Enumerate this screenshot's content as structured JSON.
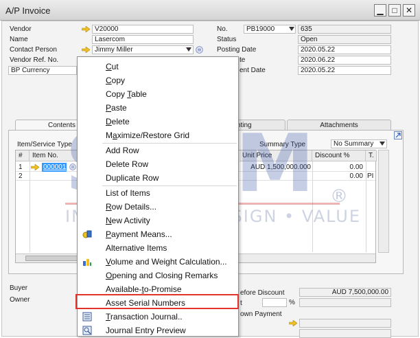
{
  "window": {
    "title": "A/P Invoice",
    "buttons": [
      "▁",
      "□",
      "✕"
    ]
  },
  "header": {
    "left": [
      {
        "label": "Vendor",
        "value": "V20000",
        "link": true
      },
      {
        "label": "Name",
        "value": "Lasercom"
      },
      {
        "label": "Contact Person",
        "value": "Jimmy Miller",
        "dropdown": true
      },
      {
        "label": "Vendor Ref. No.",
        "value": ""
      },
      {
        "label": "BP Currency",
        "value": ""
      }
    ],
    "right": {
      "no_label": "No.",
      "series": "PB19000",
      "number": "635",
      "status_label": "Status",
      "status_value": "Open",
      "posting_label": "Posting Date",
      "posting_value": "2020.05.22",
      "due_label_partial": "te",
      "due_value": "2020.06.22",
      "doc_label_partial": "ent Date",
      "doc_value": "2020.05.22"
    }
  },
  "tabs": {
    "contents": "Contents",
    "accounting_partial": "unting",
    "attachments": "Attachments"
  },
  "contents": {
    "item_type_label": "Item/Service Type",
    "summary_label": "Summary Type",
    "summary_value": "No Summary",
    "columns": [
      "#",
      "Item No.",
      "Unit Price",
      "Discount %",
      "T."
    ],
    "rows": [
      {
        "num": "1",
        "item": "000001",
        "unit_price": "AUD 1,500,000.000",
        "discount": "0.00",
        "tax": ""
      },
      {
        "num": "2",
        "item": "",
        "unit_price": "",
        "discount": "0.00",
        "tax": "PI"
      }
    ]
  },
  "footer": {
    "buyer_label": "Buyer",
    "owner_label": "Owner",
    "before_discount_label_partial": "efore Discount",
    "before_discount_value": "AUD 7,500,000.00",
    "discount_label_partial": "t",
    "percent_sign": "%",
    "down_payment_label_partial": "own Payment"
  },
  "context_menu": {
    "items": [
      {
        "label": "Cut",
        "mnemonic_index": 0
      },
      {
        "label": "Copy",
        "mnemonic_index": 0
      },
      {
        "label": "Copy Table",
        "mnemonic_index": 5
      },
      {
        "label": "Paste",
        "mnemonic_index": 0
      },
      {
        "label": "Delete",
        "mnemonic_index": 0
      },
      {
        "label": "Maximize/Restore Grid",
        "mnemonic_index": 1
      },
      {
        "label": "Add Row",
        "mnemonic_index": -1
      },
      {
        "label": "Delete Row",
        "mnemonic_index": -1
      },
      {
        "label": "Duplicate Row",
        "mnemonic_index": -1
      },
      {
        "label": "List of Items",
        "mnemonic_index": -1
      },
      {
        "label": "Row Details...",
        "mnemonic_index": 0
      },
      {
        "label": "New Activity",
        "mnemonic_index": 0
      },
      {
        "label": "Payment Means...",
        "mnemonic_index": 0
      },
      {
        "label": "Alternative Items",
        "mnemonic_index": -1
      },
      {
        "label": "Volume and Weight Calculation...",
        "mnemonic_index": 0
      },
      {
        "label": "Opening and Closing Remarks",
        "mnemonic_index": 0
      },
      {
        "label": "Available-to-Promise",
        "mnemonic_index": 10
      },
      {
        "label": "Asset Serial Numbers",
        "mnemonic_index": -1
      },
      {
        "label": "Transaction Journal..",
        "mnemonic_index": 0
      },
      {
        "label": "Journal Entry Preview",
        "mnemonic_index": -1
      }
    ],
    "highlighted": "Asset Serial Numbers"
  },
  "watermark": {
    "brand": "STEM",
    "tagline": "INNOVATION • DESIGN • VALUE",
    "registered": "®"
  },
  "colors": {
    "highlight": "#e2322a",
    "link_arrow": "#f0c020",
    "selected_cell": "#3399ff",
    "watermark": "#405ea8"
  }
}
